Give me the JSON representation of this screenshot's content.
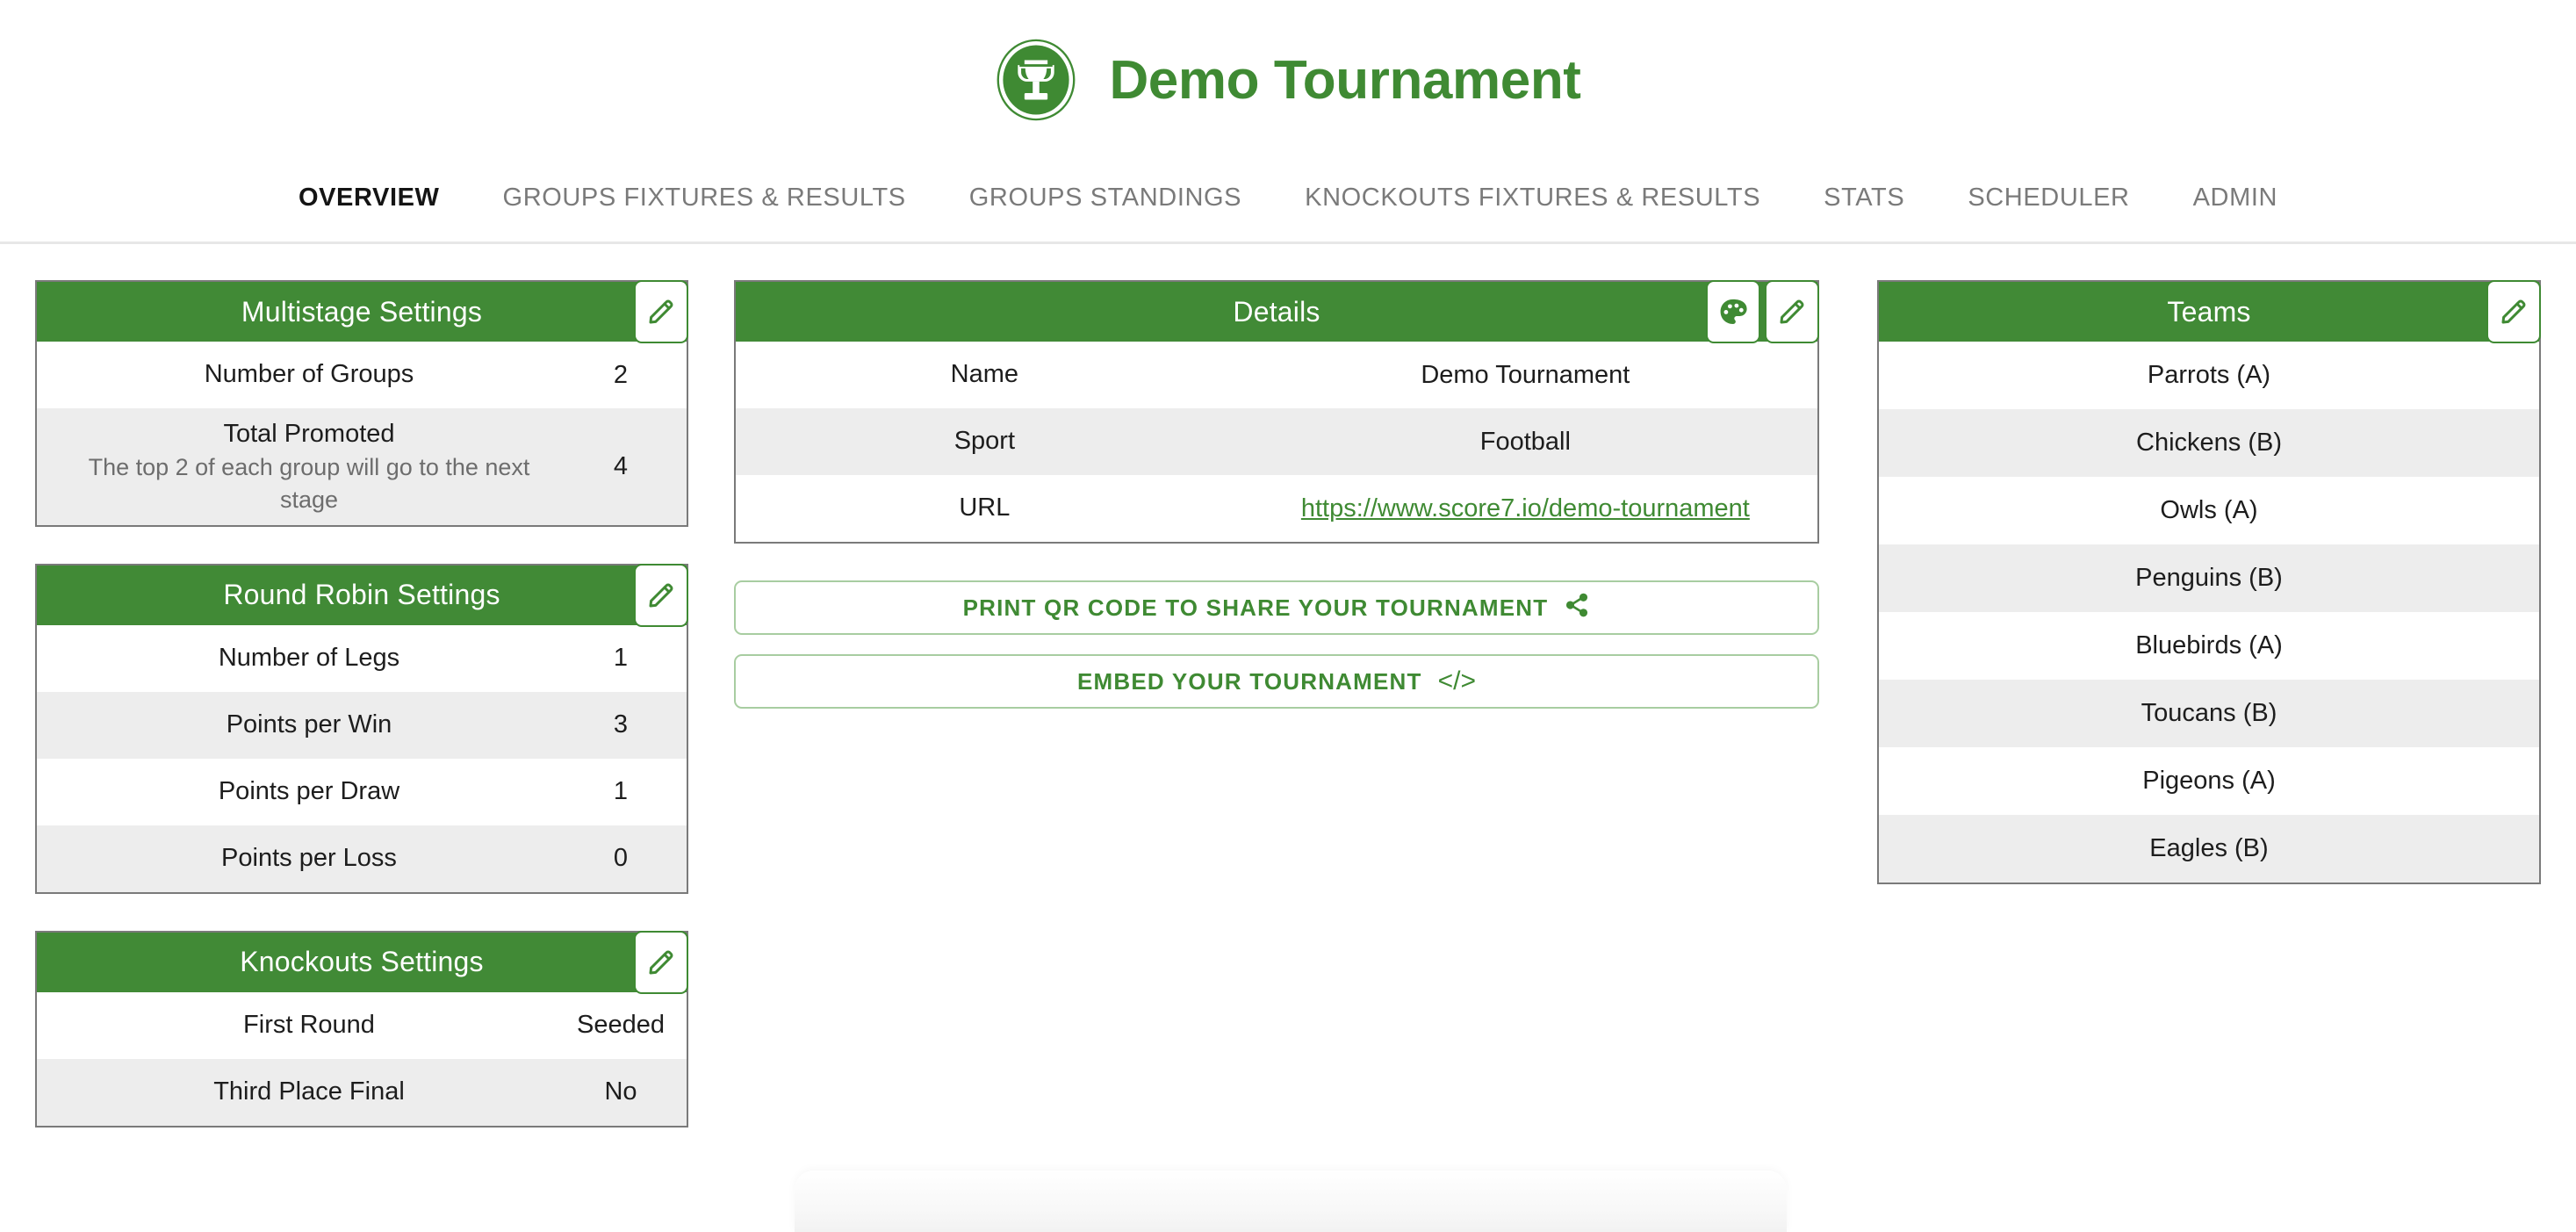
{
  "header": {
    "title": "Demo Tournament",
    "logo_icon": "trophy-icon"
  },
  "nav": {
    "items": [
      {
        "label": "OVERVIEW",
        "active": true
      },
      {
        "label": "GROUPS FIXTURES & RESULTS",
        "active": false
      },
      {
        "label": "GROUPS STANDINGS",
        "active": false
      },
      {
        "label": "KNOCKOUTS FIXTURES & RESULTS",
        "active": false
      },
      {
        "label": "STATS",
        "active": false
      },
      {
        "label": "SCHEDULER",
        "active": false
      },
      {
        "label": "ADMIN",
        "active": false
      }
    ]
  },
  "multistage": {
    "title": "Multistage Settings",
    "edit_icon": "pencil-icon",
    "rows": [
      {
        "label": "Number of Groups",
        "sub": "",
        "value": "2"
      },
      {
        "label": "Total Promoted",
        "sub": "The top 2 of each group will go to the next stage",
        "value": "4"
      }
    ]
  },
  "round_robin": {
    "title": "Round Robin Settings",
    "edit_icon": "pencil-icon",
    "rows": [
      {
        "label": "Number of Legs",
        "value": "1"
      },
      {
        "label": "Points per Win",
        "value": "3"
      },
      {
        "label": "Points per Draw",
        "value": "1"
      },
      {
        "label": "Points per Loss",
        "value": "0"
      }
    ]
  },
  "knockouts": {
    "title": "Knockouts Settings",
    "edit_icon": "pencil-icon",
    "rows": [
      {
        "label": "First Round",
        "value": "Seeded"
      },
      {
        "label": "Third Place Final",
        "value": "No"
      }
    ]
  },
  "details": {
    "title": "Details",
    "palette_icon": "palette-icon",
    "edit_icon": "pencil-icon",
    "rows": [
      {
        "label": "Name",
        "value": "Demo Tournament",
        "is_link": false
      },
      {
        "label": "Sport",
        "value": "Football",
        "is_link": false
      },
      {
        "label": "URL",
        "value": "https://www.score7.io/demo-tournament",
        "is_link": true
      }
    ]
  },
  "actions": {
    "print_qr_label": "PRINT QR CODE TO SHARE YOUR TOURNAMENT",
    "print_qr_icon": "share-icon",
    "embed_label": "EMBED YOUR TOURNAMENT",
    "embed_icon": "code-icon",
    "embed_glyph": "</>"
  },
  "teams": {
    "title": "Teams",
    "edit_icon": "pencil-icon",
    "items": [
      "Parrots (A)",
      "Chickens (B)",
      "Owls (A)",
      "Penguins (B)",
      "Bluebirds (A)",
      "Toucans (B)",
      "Pigeons (A)",
      "Eagles (B)"
    ]
  },
  "colors": {
    "brand_green": "#3F8A33",
    "header_green": "#418A36",
    "alt_row": "#ededed",
    "nav_inactive": "#7a7a7a"
  }
}
